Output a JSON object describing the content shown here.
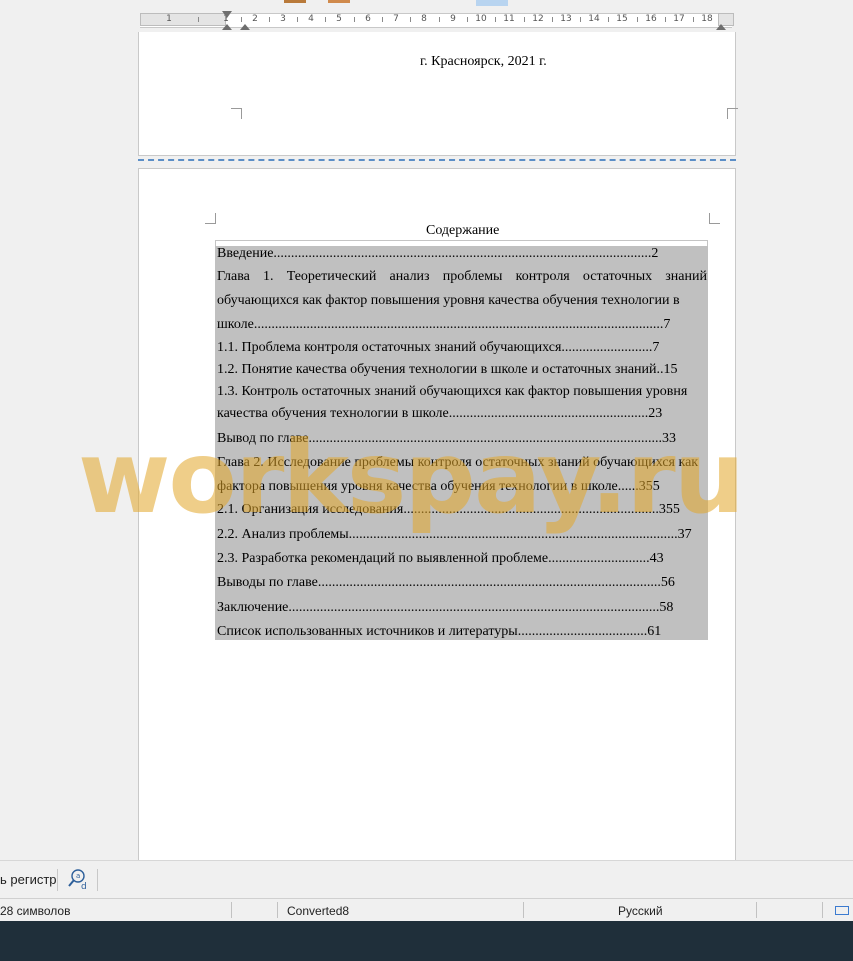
{
  "ruler": {
    "ticks": [
      "1",
      "1",
      "2",
      "3",
      "4",
      "5",
      "6",
      "7",
      "8",
      "9",
      "10",
      "11",
      "12",
      "13",
      "14",
      "15",
      "16",
      "17",
      "18"
    ]
  },
  "page1": {
    "city_line": "г. Красноярск, 2021 г."
  },
  "page2": {
    "toc_title": "Содержание",
    "toc": [
      "Введение............................................................................................................2",
      "Глава 1. Теоретический анализ проблемы контроля остаточных знаний",
      "обучающихся как фактор повышения уровня качества обучения технологии в",
      "школе.....................................................................................................................7",
      "1.1.  Проблема контроля остаточных знаний обучающихся..........................7",
      "1.2.  Понятие качества обучения технологии в школе и остаточных знаний..15",
      "1.3.  Контроль остаточных знаний обучающихся как фактор повышения уровня",
      "качества обучения технологии в школе.........................................................23",
      "Вывод по главе.....................................................................................................33",
      "Глава 2. Исследование проблемы контроля остаточных знаний обучающихся как",
      "фактора повышения уровня качества обучения технологии в школе......355",
      "2.1.   Организация исследования.........................................................................355",
      "2.2.   Анализ проблемы..............................................................................................37",
      "2.3.   Разработка рекомендаций по выявленной проблеме.............................43",
      "Выводы по главе..................................................................................................56",
      "Заключение..........................................................................................................58",
      "Список использованных источников и литературы.....................................61"
    ]
  },
  "watermark": "workspay.ru",
  "findbar": {
    "match_case_label": "ь регистр",
    "find_icon": "find-replace-icon"
  },
  "statusbar": {
    "char_count": "28 символов",
    "page_style": "Converted8",
    "language": "Русский",
    "layout_icon": "single-page-view-icon"
  },
  "colors": {
    "selection": "#c0c0c0",
    "watermark": "#e1a528",
    "page_break": "#5b8ec7",
    "taskbar": "#1f2f3a"
  }
}
